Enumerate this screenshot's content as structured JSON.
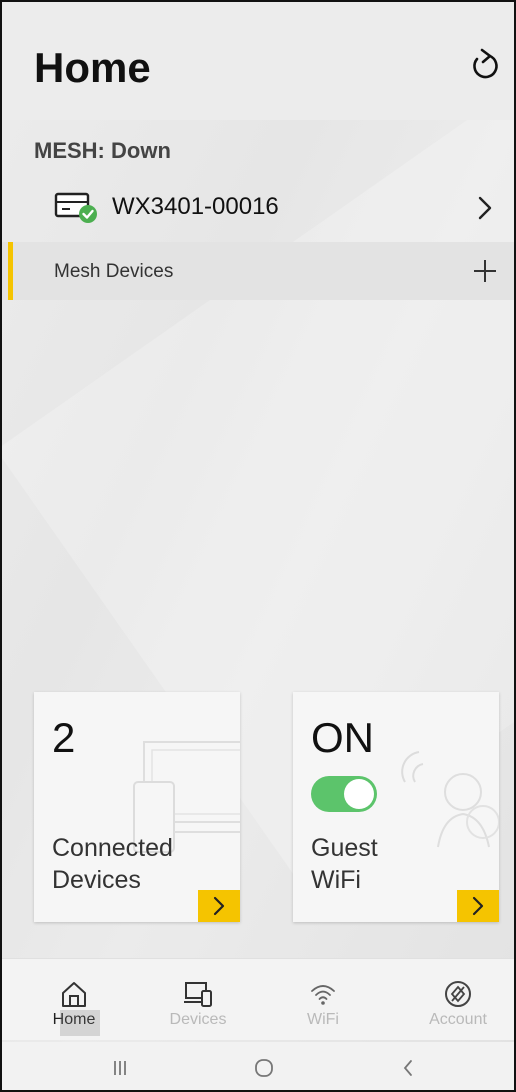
{
  "header": {
    "title": "Home",
    "refresh_icon": "refresh-icon"
  },
  "mesh": {
    "status": "MESH: Down",
    "router": {
      "name": "WX3401-00016",
      "icon": "router-ok-icon"
    },
    "devices_label": "Mesh Devices",
    "accent_color": "#f5c400"
  },
  "cards": {
    "connected": {
      "count": "2",
      "label_line1": "Connected",
      "label_line2": "Devices"
    },
    "guest": {
      "status": "ON",
      "enabled": true,
      "label_line1": "Guest",
      "label_line2": "WiFi"
    }
  },
  "bottom_nav": {
    "active": "Home",
    "items": [
      {
        "label": "Home",
        "icon": "home-icon"
      },
      {
        "label": "Devices",
        "icon": "devices-icon"
      },
      {
        "label": "WiFi",
        "icon": "wifi-icon"
      },
      {
        "label": "Account",
        "icon": "account-icon"
      }
    ]
  },
  "colors": {
    "accent": "#f5c400",
    "toggle_on": "#5cc46b",
    "status_ok": "#4caf50"
  }
}
